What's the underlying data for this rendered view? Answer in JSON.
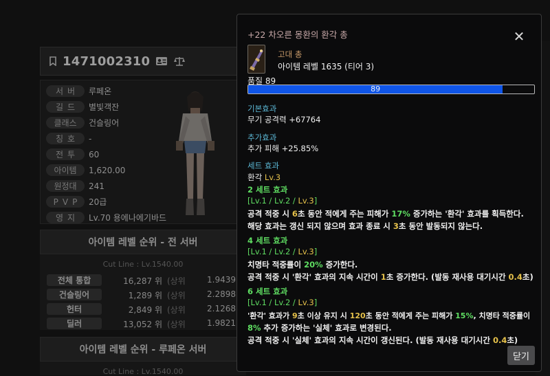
{
  "profile": {
    "code": "1471002310",
    "rows": [
      {
        "label": "서버",
        "value": "루페온"
      },
      {
        "label": "길드",
        "value": "별빛객잔"
      },
      {
        "label": "클래스",
        "value": "건슬링어"
      },
      {
        "label": "칭호",
        "value": "-"
      },
      {
        "label": "전투",
        "value": "60"
      },
      {
        "label": "아이템",
        "value": "1,620.00"
      },
      {
        "label": "원정대",
        "value": "241"
      },
      {
        "label": "PVP",
        "value": "20급"
      },
      {
        "label": "영지",
        "value": "Lv.70 용에나에기바드"
      }
    ]
  },
  "ranking_all": {
    "title": "아이템 레벨 순위 - 전 서버",
    "cutline": "Cut Line : Lv.1540.00",
    "rows": [
      {
        "label": "전체 통합",
        "rank": "16,287 위",
        "tag": "(상위",
        "pct": "1.9439"
      },
      {
        "label": "건슬링어",
        "rank": "1,289 위",
        "tag": "(상위",
        "pct": "2.2898"
      },
      {
        "label": "헌터",
        "rank": "2,849 위",
        "tag": "(상위",
        "pct": "2.1268"
      },
      {
        "label": "딜러",
        "rank": "13,052 위",
        "tag": "(상위",
        "pct": "1.9821"
      }
    ]
  },
  "ranking_server": {
    "title": "아이템 레벨 순위 - 루페온 서버",
    "cutline": "Cut Line : Lv.1540.00"
  },
  "tooltip": {
    "title": "+22 차오른 몽환의 환각 총",
    "close_icon": "close-x-icon",
    "grade": "고대 총",
    "item_level": "아이템 레벨 1635 (티어 3)",
    "quality_label": "품질 89",
    "quality_value": 89,
    "quality_text": "89",
    "base_head": "기본효과",
    "base_line": "무기 공격력 +67764",
    "extra_head": "추가효과",
    "extra_line": "추가 피해 +25.85%",
    "set_head": "세트 효과",
    "set_name": "환각 ",
    "set_lv": "Lv.3",
    "set2": {
      "head": "2 세트 효과",
      "lv_open": "[Lv.1 / Lv.2 / ",
      "lv_cur": "Lv.3",
      "lv_close": "]",
      "l1a": "공격 적중 시 ",
      "l1b": "6",
      "l1c": "초 동안 적에게 주는 피해가 ",
      "l1d": "17%",
      "l1e": " 증가하는 '환각' 효과를 획득한다.",
      "l2a": "해당 효과는 갱신 되지 않으며 효과 종료 시 ",
      "l2b": "3",
      "l2c": "초 동안 발동되지 않는다."
    },
    "set4": {
      "head": "4 세트 효과",
      "lv_open": "[Lv.1 / Lv.2 / ",
      "lv_cur": "Lv.3",
      "lv_close": "]",
      "l1a": "치명타 적중률이 ",
      "l1b": "20%",
      "l1c": " 증가한다.",
      "l2a": "공격 적중 시 '환각' 효과의 지속 시간이 ",
      "l2b": "1",
      "l2c": "초 증가한다. (발동 재사용 대기시간 ",
      "l2d": "0.4",
      "l2e": "초)"
    },
    "set6": {
      "head": "6 세트 효과",
      "lv_open": "[Lv.1 / Lv.2 / ",
      "lv_cur": "Lv.3",
      "lv_close": "]",
      "l1a": "'환각' 효과가 ",
      "l1b": "9",
      "l1c": "초 이상 유지 시 ",
      "l1d": "120",
      "l1e": "초 동안 적에게 주는 피해가 ",
      "l1f": "15%",
      "l1g": ", 치명타 적중률이",
      "l2a": "8%",
      "l2b": " 추가 증가하는 '실체' 효과로 변경된다.",
      "l3a": "공격 적중 시 '실체' 효과의 지속 시간이 갱신된다. (발동 재사용 대기시간 ",
      "l3b": "0.4",
      "l3c": "초)"
    },
    "close_button": "닫기"
  }
}
